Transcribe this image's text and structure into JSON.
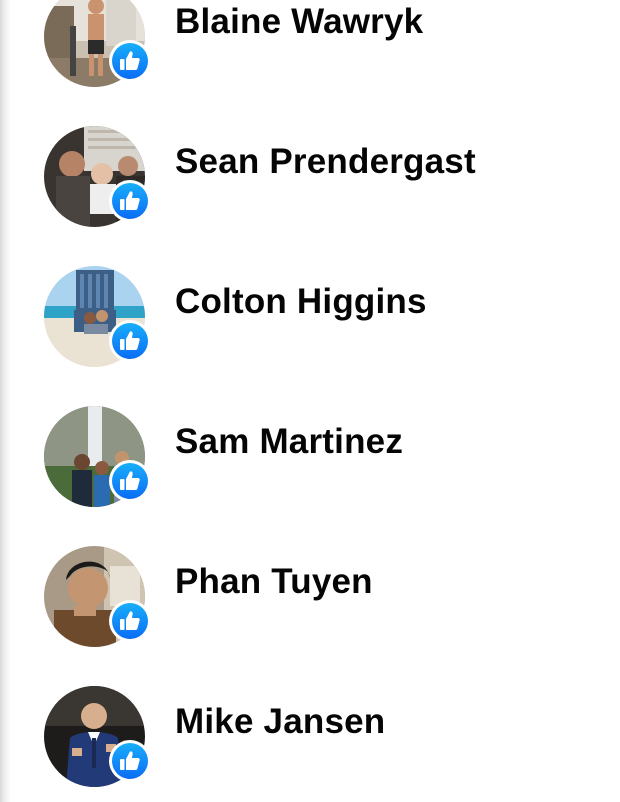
{
  "likes_list": {
    "people": [
      {
        "name": "Blaine Wawryk",
        "reaction": "like-icon"
      },
      {
        "name": "Sean Prendergast",
        "reaction": "like-icon"
      },
      {
        "name": "Colton Higgins",
        "reaction": "like-icon"
      },
      {
        "name": "Sam Martinez",
        "reaction": "like-icon"
      },
      {
        "name": "Phan Tuyen",
        "reaction": "like-icon"
      },
      {
        "name": "Mike Jansen",
        "reaction": "like-icon"
      }
    ]
  },
  "colors": {
    "like_badge_top": "#18aefa",
    "like_badge_bottom": "#0a6cf6",
    "name_text": "#050505",
    "background": "#ffffff"
  }
}
